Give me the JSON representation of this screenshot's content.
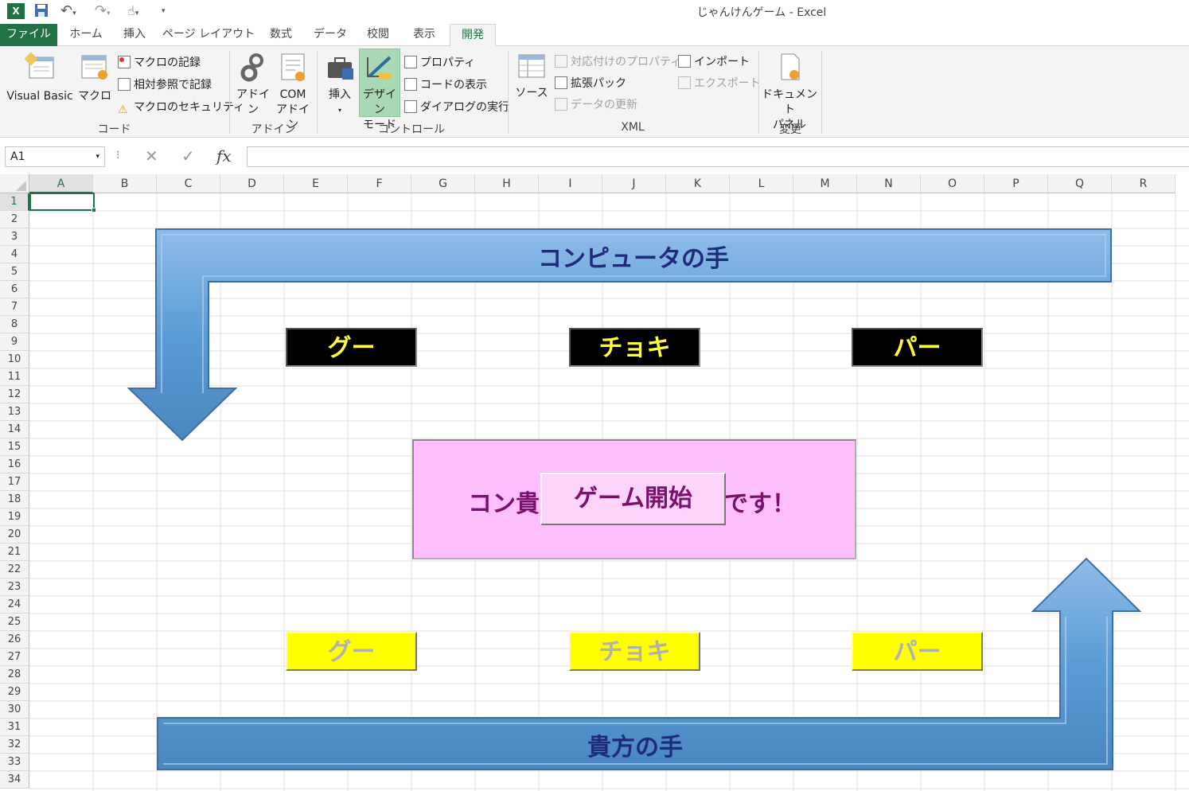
{
  "window": {
    "title": "じゃんけんゲーム - Excel"
  },
  "tabs": [
    {
      "label": "ファイル"
    },
    {
      "label": "ホーム"
    },
    {
      "label": "挿入"
    },
    {
      "label": "ページ レイアウト"
    },
    {
      "label": "数式"
    },
    {
      "label": "データ"
    },
    {
      "label": "校閲"
    },
    {
      "label": "表示"
    },
    {
      "label": "開発"
    }
  ],
  "ribbon": {
    "code": {
      "visual_basic": "Visual Basic",
      "macro": "マクロ",
      "record_macro": "マクロの記録",
      "relative_ref": "相対参照で記録",
      "macro_security": "マクロのセキュリティ",
      "label": "コード"
    },
    "addins": {
      "addin": "アドイン",
      "com_addin_1": "COM",
      "com_addin_2": "アドイン",
      "label": "アドイン"
    },
    "controls": {
      "insert": "挿入",
      "design_mode_1": "デザイン",
      "design_mode_2": "モード",
      "properties": "プロパティ",
      "view_code": "コードの表示",
      "run_dialog": "ダイアログの実行",
      "label": "コントロール"
    },
    "xml": {
      "source": "ソース",
      "map_properties": "対応付けのプロパティ",
      "expansion_packs": "拡張パック",
      "refresh_data": "データの更新",
      "import": "インポート",
      "export": "エクスポート",
      "label": "XML"
    },
    "modify": {
      "doc_panel_1": "ドキュメント",
      "doc_panel_2": "パネル",
      "label": "変更"
    }
  },
  "formula_bar": {
    "name_box": "A1",
    "fx": "fx",
    "formula": ""
  },
  "columns": [
    "A",
    "B",
    "C",
    "D",
    "E",
    "F",
    "G",
    "H",
    "I",
    "J",
    "K",
    "L",
    "M",
    "N",
    "O",
    "P",
    "Q",
    "R"
  ],
  "rows": [
    "1",
    "2",
    "3",
    "4",
    "5",
    "6",
    "7",
    "8",
    "9",
    "10",
    "11",
    "12",
    "13",
    "14",
    "15",
    "16",
    "17",
    "18",
    "19",
    "20",
    "21",
    "22",
    "23",
    "24",
    "25",
    "26",
    "27",
    "28",
    "29",
    "30",
    "31",
    "32",
    "33",
    "34"
  ],
  "selected_cell": "A1",
  "sheet": {
    "computer_label": "コンピュータの手",
    "player_label": "貴方の手",
    "computer_hands": [
      "グー",
      "チョキ",
      "パー"
    ],
    "player_hands": [
      "グー",
      "チョキ",
      "パー"
    ],
    "message_left": "コン貴",
    "message_right": "です！",
    "start_button": "ゲーム開始"
  },
  "colors": {
    "excel_green": "#217346",
    "arrow_blue": "#5b9bd5",
    "label_navy": "#1f2a7a",
    "computer_button_bg": "#000000",
    "computer_button_text": "#ffff33",
    "player_button_bg": "#ffff00",
    "player_button_text": "#b0b0b0",
    "message_bg": "#ffbfff",
    "message_text": "#7a0f6e"
  }
}
